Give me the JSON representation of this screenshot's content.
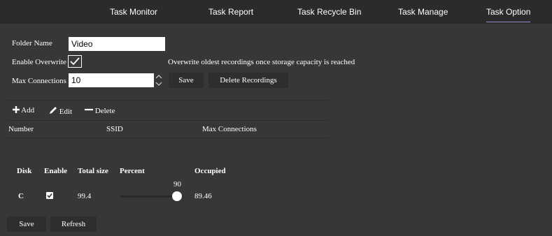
{
  "tabs": [
    "Task Monitor",
    "Task Report",
    "Task Recycle Bin",
    "Task Manage",
    "Task Option"
  ],
  "form": {
    "folder_label": "Folder Name",
    "folder_value": "Video",
    "overwrite_label": "Enable Overwrite",
    "overwrite_checked": true,
    "overwrite_hint": "Overwrite oldest recordings once storage capacity is reached",
    "max_conn_label": "Max Connections",
    "max_conn_value": "10",
    "save_label": "Save",
    "delete_label": "Delete Recordings"
  },
  "toolbar": {
    "add": "Add",
    "edit": "Edit",
    "delete": "Delete"
  },
  "table": {
    "headers": [
      "Number",
      "SSID",
      "Max Connections"
    ]
  },
  "disks": {
    "headers": [
      "Disk",
      "Enable",
      "Total size",
      "Percent",
      "Occupied"
    ],
    "rows": [
      {
        "disk": "C",
        "enabled": true,
        "total": "99.4",
        "percent_label": "90",
        "percent_value": 90,
        "occupied": "89.46"
      }
    ]
  },
  "bottom": {
    "save": "Save",
    "refresh": "Refresh"
  },
  "colors": {
    "background": "#373737",
    "topbar": "#2b2b2b",
    "active_tab_underline": "#9d8fc8",
    "button": "#2e2e2e"
  }
}
